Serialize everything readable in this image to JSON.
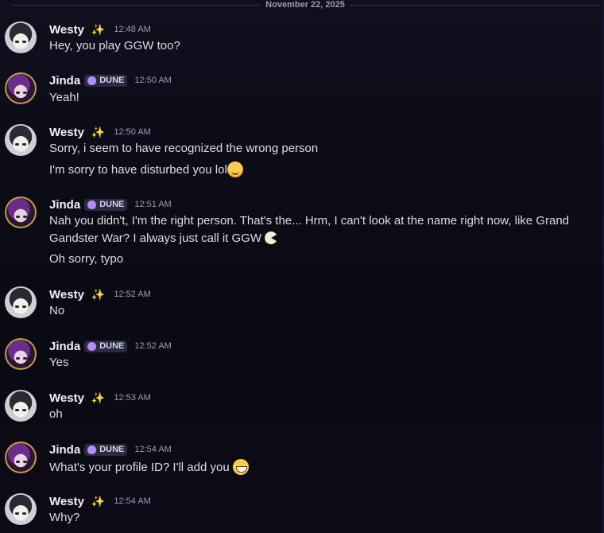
{
  "date_divider": "November 22, 2025",
  "users": {
    "westy": {
      "name": "Westy",
      "decoration": "✨"
    },
    "jinda": {
      "name": "Jinda",
      "badge": "DUNE"
    }
  },
  "messages": [
    {
      "author": "Westy",
      "time": "12:48 AM",
      "lines": [
        "Hey, you play GGW too?"
      ]
    },
    {
      "author": "Jinda",
      "time": "12:50 AM",
      "lines": [
        "Yeah!"
      ]
    },
    {
      "author": "Westy",
      "time": "12:50 AM",
      "lines": [
        "Sorry, i seem to have recognized the wrong person",
        "I'm sorry to have disturbed you lol"
      ],
      "emoji": "smiling-face-icon"
    },
    {
      "author": "Jinda",
      "time": "12:51 AM",
      "lines": [
        "Nah you didn't, I'm the right person. That's the... Hrm, I can't look at the name right now, like Grand",
        "Gandster War? I always just call it GGW",
        "Oh sorry, typo"
      ],
      "emoji": "pacman-icon"
    },
    {
      "author": "Westy",
      "time": "12:52 AM",
      "lines": [
        "No"
      ]
    },
    {
      "author": "Jinda",
      "time": "12:52 AM",
      "lines": [
        "Yes"
      ]
    },
    {
      "author": "Westy",
      "time": "12:53 AM",
      "lines": [
        "oh"
      ]
    },
    {
      "author": "Jinda",
      "time": "12:54 AM",
      "lines": [
        "What's your profile ID? I'll add you"
      ],
      "emoji": "grinning-face-icon"
    },
    {
      "author": "Westy",
      "time": "12:54 AM",
      "lines": [
        "Why?"
      ]
    }
  ]
}
